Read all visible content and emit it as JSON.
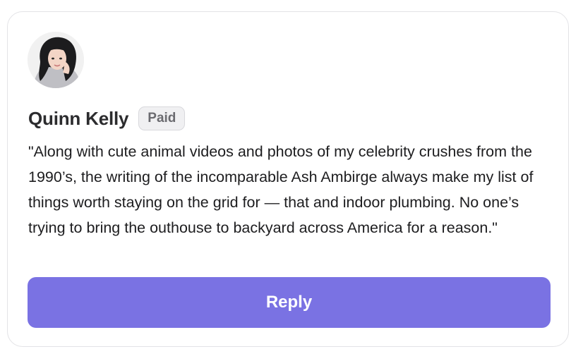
{
  "review": {
    "author_name": "Quinn Kelly",
    "badge": "Paid",
    "quote": "\"Along with cute animal videos and photos of my celebrity crushes from the 1990’s, the writing of the incomparable Ash Ambirge always make my list of things worth staying on the grid for — that and indoor plumbing. No one’s trying to bring the outhouse to backyard across America for a reason.\""
  },
  "actions": {
    "reply_label": "Reply"
  },
  "colors": {
    "accent": "#7a72e3",
    "card_border": "#e3e3e6",
    "badge_bg": "#f0f0f2"
  }
}
